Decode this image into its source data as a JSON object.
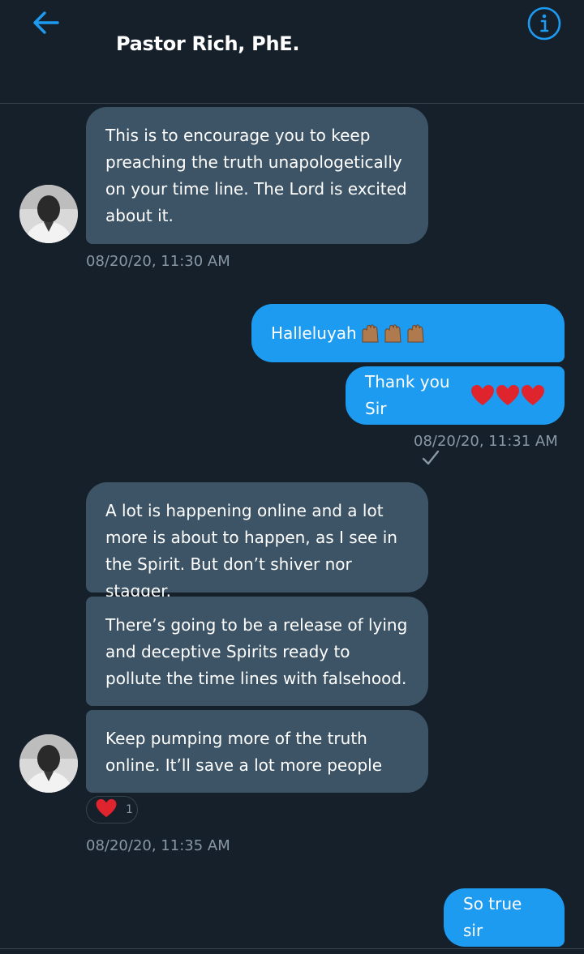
{
  "header": {
    "title": "Pastor Rich, PhE."
  },
  "colors": {
    "background": "#15202b",
    "incoming_bubble": "#3d5466",
    "outgoing_bubble": "#1d9bf0",
    "accent": "#1d9bf0",
    "timestamp": "#8899a6"
  },
  "messages": [
    {
      "direction": "in",
      "text": "This is to encourage you to keep preaching the truth unapologetically on your time line. The Lord is excited about it."
    },
    {
      "direction": "out",
      "text": "Halleluyah",
      "emoji": [
        "raised-hands",
        "raised-hands",
        "raised-hands"
      ]
    },
    {
      "direction": "out",
      "text": "Thank you Sir",
      "emoji": [
        "red-heart",
        "red-heart",
        "red-heart"
      ]
    },
    {
      "direction": "in",
      "text": "A lot is happening online and a lot more is about to happen, as I see in the Spirit. But don’t shiver nor stagger."
    },
    {
      "direction": "in",
      "text": "There’s going to be a release of lying and deceptive Spirits ready to pollute the time lines with falsehood."
    },
    {
      "direction": "in",
      "text": "Keep pumping more of the truth online. It’ll save a lot more people"
    },
    {
      "direction": "out",
      "text": "So true sir"
    }
  ],
  "timestamps": [
    "08/20/20, 11:30 AM",
    "08/20/20, 11:31 AM",
    "08/20/20, 11:35 AM"
  ],
  "reaction": {
    "icon": "red-heart",
    "count": "1"
  },
  "icons": {
    "back": "arrow-left-icon",
    "info": "info-circle-icon",
    "read": "checkmark-icon"
  }
}
